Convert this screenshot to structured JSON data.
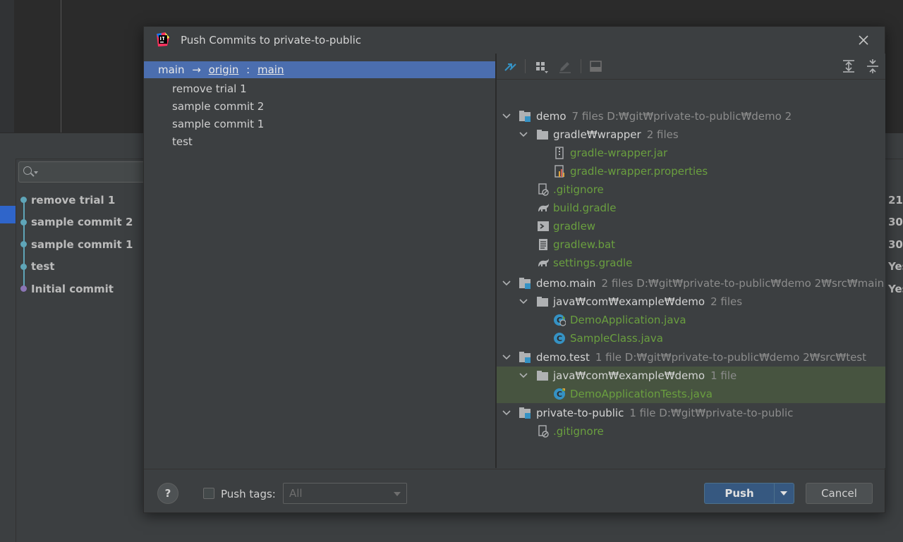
{
  "background": {
    "log": {
      "commits": [
        {
          "message": "remove trial 1",
          "date": "21"
        },
        {
          "message": "sample commit 2",
          "date": "30"
        },
        {
          "message": "sample commit 1",
          "date": "30"
        },
        {
          "message": "test",
          "date": "Yes"
        },
        {
          "message": "Initial commit",
          "date": "Yes"
        }
      ]
    }
  },
  "dialog": {
    "title": "Push Commits to private-to-public",
    "branch": {
      "local": "main",
      "arrow": "→",
      "remote": "origin",
      "colon": ":",
      "remote_branch": "main"
    },
    "commits": [
      "remove trial 1",
      "sample commit 2",
      "sample commit 1",
      "test"
    ],
    "tree": {
      "modules": [
        {
          "name": "demo",
          "meta": "7 files  D:₩git₩private-to-public₩demo 2",
          "folders": [
            {
              "name": "gradle₩wrapper",
              "meta": "2 files",
              "files": [
                "gradle-wrapper.jar",
                "gradle-wrapper.properties"
              ]
            }
          ],
          "files": [
            ".gitignore",
            "build.gradle",
            "gradlew",
            "gradlew.bat",
            "settings.gradle"
          ]
        },
        {
          "name": "demo.main",
          "meta": "2 files  D:₩git₩private-to-public₩demo 2₩src₩main",
          "folders": [
            {
              "name": "java₩com₩example₩demo",
              "meta": "2 files",
              "files": [
                "DemoApplication.java",
                "SampleClass.java"
              ]
            }
          ]
        },
        {
          "name": "demo.test",
          "meta": "1 file  D:₩git₩private-to-public₩demo 2₩src₩test",
          "folders": [
            {
              "name": "java₩com₩example₩demo",
              "meta": "1 file",
              "files": [
                "DemoApplicationTests.java"
              ]
            }
          ]
        },
        {
          "name": "private-to-public",
          "meta": "1 file  D:₩git₩private-to-public",
          "files": [
            ".gitignore"
          ]
        }
      ]
    },
    "footer": {
      "help": "?",
      "push_tags_label": "Push tags:",
      "push_tags_value": "All",
      "push_label": "Push",
      "cancel_label": "Cancel"
    },
    "colors": {
      "selection": "#4b6eaf",
      "modified_file": "#6a9f3f",
      "highlight_row": "#475440",
      "primary_button": "#365880"
    }
  }
}
